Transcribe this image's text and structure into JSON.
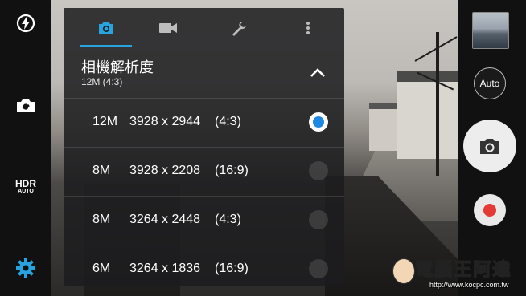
{
  "left_bar": {
    "flash_icon": "flash-auto-icon",
    "switch_camera_icon": "switch-camera-icon",
    "hdr_label": "HDR",
    "hdr_sub": "AUTO",
    "settings_icon": "gear-icon",
    "accent_color": "#29a3e0"
  },
  "right_bar": {
    "auto_label": "Auto",
    "shutter_icon": "camera-icon",
    "record_color": "#e53935"
  },
  "panel": {
    "tabs": [
      {
        "name": "camera-tab",
        "icon": "camera-icon",
        "active": true
      },
      {
        "name": "video-tab",
        "icon": "video-camera-icon",
        "active": false
      },
      {
        "name": "tools-tab",
        "icon": "wrench-icon",
        "active": false
      },
      {
        "name": "more-tab",
        "icon": "more-vertical-icon",
        "active": false
      }
    ],
    "section": {
      "title": "相機解析度",
      "value": "12M (4:3)"
    },
    "options": [
      {
        "mp": "12M",
        "resolution": "3928 x 2944",
        "ratio": "(4:3)",
        "selected": true
      },
      {
        "mp": "8M",
        "resolution": "3928 x 2208",
        "ratio": "(16:9)",
        "selected": false
      },
      {
        "mp": "8M",
        "resolution": "3264 x 2448",
        "ratio": "(4:3)",
        "selected": false
      },
      {
        "mp": "6M",
        "resolution": "3264 x 1836",
        "ratio": "(16:9)",
        "selected": false
      }
    ]
  },
  "watermark": {
    "text": "電腦王阿達",
    "url": "http://www.kocpc.com.tw"
  }
}
